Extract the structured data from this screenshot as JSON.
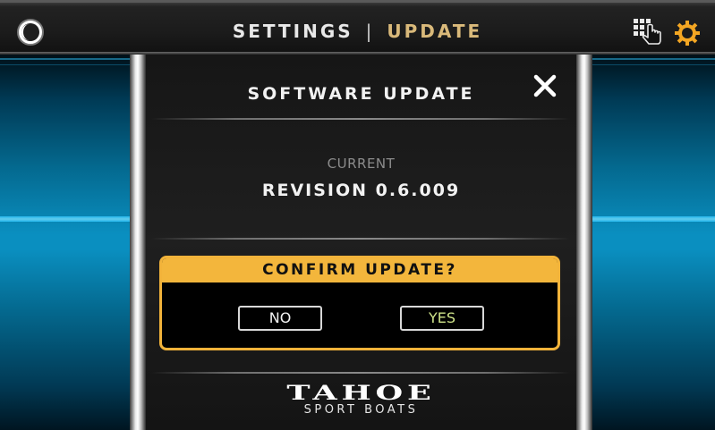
{
  "header": {
    "settings_label": "SETTINGS",
    "separator": "|",
    "update_label": "UPDATE",
    "icons": {
      "left": "moon-icon",
      "keypad": "keypad-touch-icon",
      "gear": "gear-icon"
    }
  },
  "dialog": {
    "title": "SOFTWARE UPDATE",
    "close_icon": "close-icon",
    "current_label": "CURRENT",
    "revision": "REVISION 0.6.009",
    "confirm": {
      "heading": "CONFIRM UPDATE?",
      "no_label": "NO",
      "yes_label": "YES"
    },
    "logo": {
      "main": "TAHOE",
      "sub": "SPORT BOATS"
    }
  },
  "colors": {
    "accent": "#f3b63c",
    "update_title": "#d9b97a",
    "yes_text": "#cfe38a",
    "side_glow": "#0a8fc0"
  }
}
